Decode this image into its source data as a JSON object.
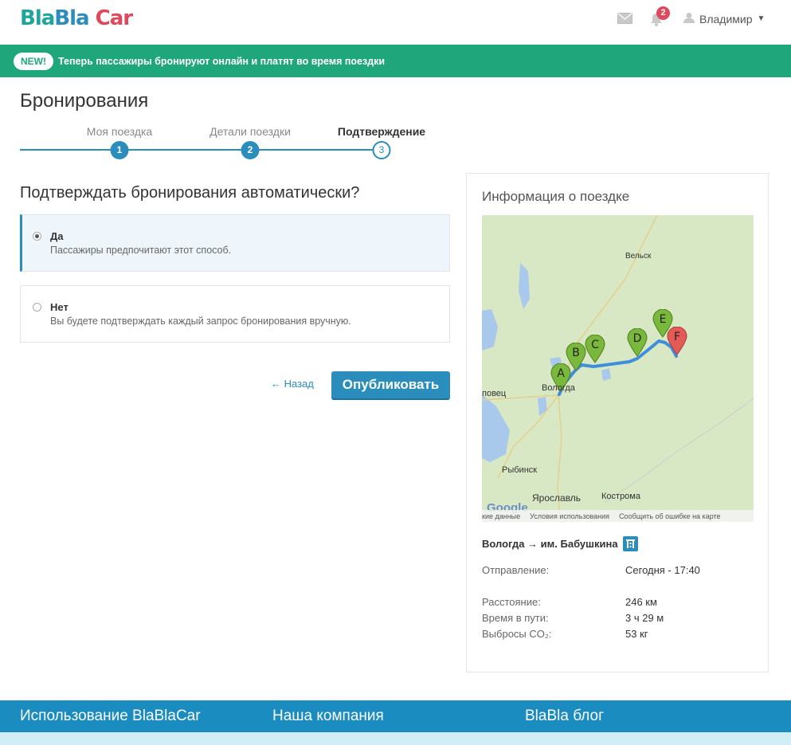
{
  "header": {
    "logo": {
      "part1": "Bla",
      "part2": "Bla",
      "part3": "Car"
    },
    "notifications_count": "2",
    "username": "Владимир"
  },
  "banner": {
    "badge": "NEW!",
    "text": "Теперь пассажиры бронируют онлайн и платят во время поездки"
  },
  "page_title": "Бронирования",
  "steps": [
    {
      "label": "Моя поездка",
      "number": "1"
    },
    {
      "label": "Детали поездки",
      "number": "2"
    },
    {
      "label": "Подтверждение",
      "number": "3"
    }
  ],
  "question": "Подтверждать бронирования автоматически?",
  "options": [
    {
      "title": "Да",
      "description": "Пассажиры предпочитают этот способ.",
      "selected": true
    },
    {
      "title": "Нет",
      "description": "Вы будете подтверждать каждый запрос бронирования вручную.",
      "selected": false
    }
  ],
  "actions": {
    "back": "← Назад",
    "publish": "Опубликовать"
  },
  "trip_info": {
    "title": "Информация о поездке",
    "map": {
      "cities": [
        "Вельск",
        "Вологда",
        "повец",
        "Рыбинск",
        "Ярославль",
        "Кострома"
      ],
      "markers": [
        "A",
        "B",
        "C",
        "D",
        "E",
        "F"
      ],
      "footer": [
        "кие данные",
        "Условия использования",
        "Сообщить об ошибке на карте"
      ],
      "google": "Google"
    },
    "route": "Вологда → им. Бабушкина",
    "departure_label": "Отправление:",
    "departure_value": "Сегодня - 17:40",
    "distance_label": "Расстояние:",
    "distance_value": "246 км",
    "duration_label": "Время в пути:",
    "duration_value": "3 ч 29 м",
    "co2_label": "Выбросы CO₂:",
    "co2_value": "53 кг"
  },
  "footer": {
    "col1": "Использование BlaBlaCar",
    "col2": "Наша компания",
    "col3": "BlaBla блог"
  },
  "colors": {
    "brand_blue": "#2a8dbb",
    "banner_green": "#1fa67a",
    "marker_green": "#7ab83c",
    "marker_red": "#e45a56"
  }
}
